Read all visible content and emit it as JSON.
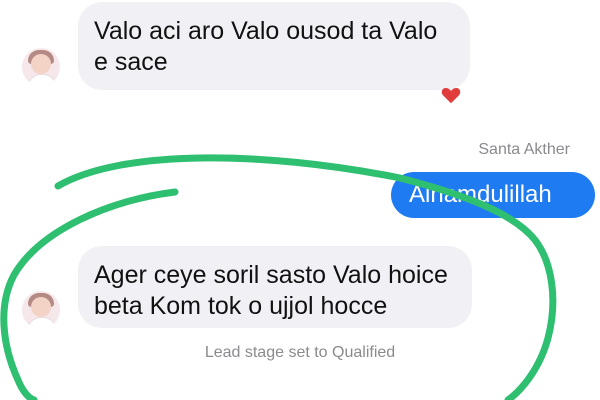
{
  "conversation": {
    "messages": [
      {
        "text": "Valo aci aro Valo ousod ta Valo e sace"
      },
      {
        "sender": "Santa Akther",
        "text": "Alhamdulillah"
      },
      {
        "text": "Ager ceye soril sasto Valo hoice beta Kom tok o ujjol hocce"
      }
    ],
    "system_note": "Lead stage set to Qualified"
  },
  "reaction": {
    "icon": "heart-icon",
    "color": "#e03c3c"
  },
  "colors": {
    "outgoing_bubble": "#1f7bf2",
    "incoming_bubble": "#f1f0f5",
    "annotation_stroke": "#2fbf71"
  }
}
